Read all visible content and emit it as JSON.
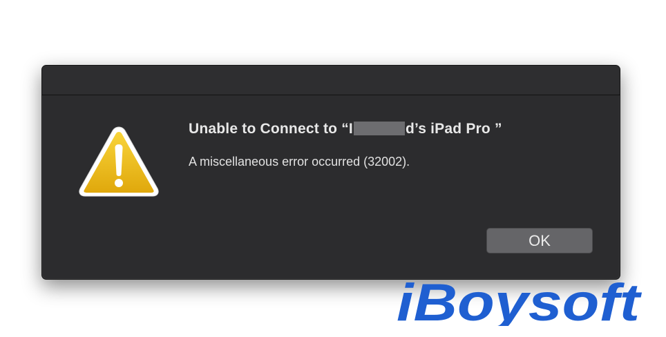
{
  "dialog": {
    "title_prefix": "Unable to Connect to “I",
    "title_suffix": "d’s iPad Pro ”",
    "message": "A miscellaneous error occurred (32002).",
    "ok_label": "OK",
    "icon": "warning-icon"
  },
  "watermark": {
    "text": "iBoysoft",
    "color": "#1f5fd1"
  },
  "colors": {
    "dialog_background": "#2c2c2e",
    "button_background": "#656568",
    "warning_yellow": "#f2c21a"
  }
}
